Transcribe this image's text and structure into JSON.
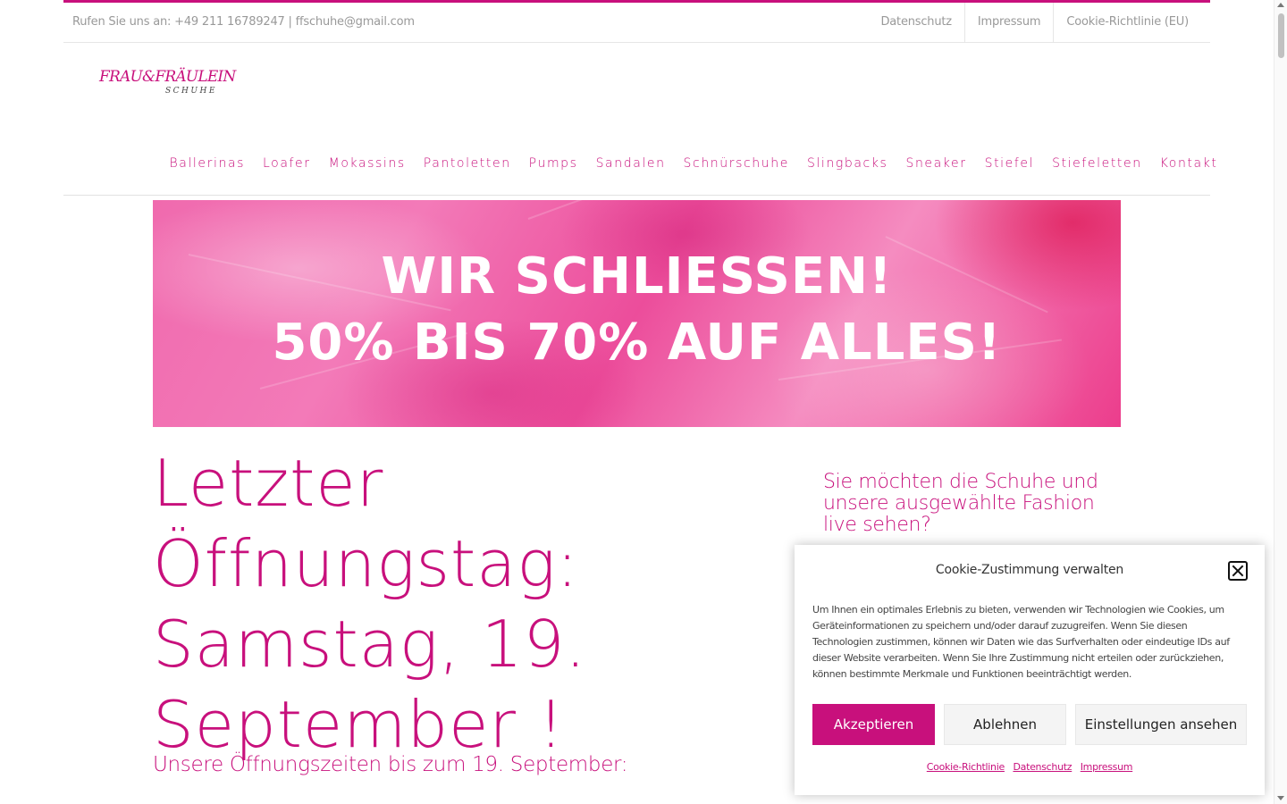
{
  "colors": {
    "accent": "#c8107c"
  },
  "topbar": {
    "contact_text": "Rufen Sie uns an: +49 211 16789247 | ffschuhe@gmail.com",
    "links": [
      "Datenschutz",
      "Impressum",
      "Cookie-Richtlinie (EU)"
    ]
  },
  "logo": {
    "line1": "FRAU&FRÄULEIN",
    "line2": "SCHUHE"
  },
  "nav": {
    "items": [
      "Ballerinas",
      "Loafer",
      "Mokassins",
      "Pantoletten",
      "Pumps",
      "Sandalen",
      "Schnürschuhe",
      "Slingbacks",
      "Sneaker",
      "Stiefel",
      "Stiefeletten",
      "Kontakt"
    ]
  },
  "banner": {
    "line1": "WIR SCHLIESSEN!",
    "line2": "50% BIS 70% AUF ALLES!"
  },
  "main": {
    "headline_line1": "Letzter Öffnungstag:",
    "headline_line2": "Samstag, 19.",
    "headline_line3": "September !",
    "subhead": "Unsere Öffnungszeiten bis zum 19. September:"
  },
  "sidebar": {
    "title": "Sie möchten die Schuhe und unsere ausgewählte Fashion live sehen?"
  },
  "cookie": {
    "title": "Cookie-Zustimmung verwalten",
    "text": "Um Ihnen ein optimales Erlebnis zu bieten, verwenden wir Technologien wie Cookies, um Geräteinformationen zu speichern und/oder darauf zuzugreifen. Wenn Sie diesen Technologien zustimmen, können wir Daten wie das Surfverhalten oder eindeutige IDs auf dieser Website verarbeiten. Wenn Sie Ihre Zustimmung nicht erteilen oder zurückziehen, können bestimmte Merkmale und Funktionen beeinträchtigt werden.",
    "accept": "Akzeptieren",
    "deny": "Ablehnen",
    "settings": "Einstellungen ansehen",
    "links": [
      "Cookie-Richtlinie",
      "Datenschutz",
      "Impressum"
    ]
  }
}
